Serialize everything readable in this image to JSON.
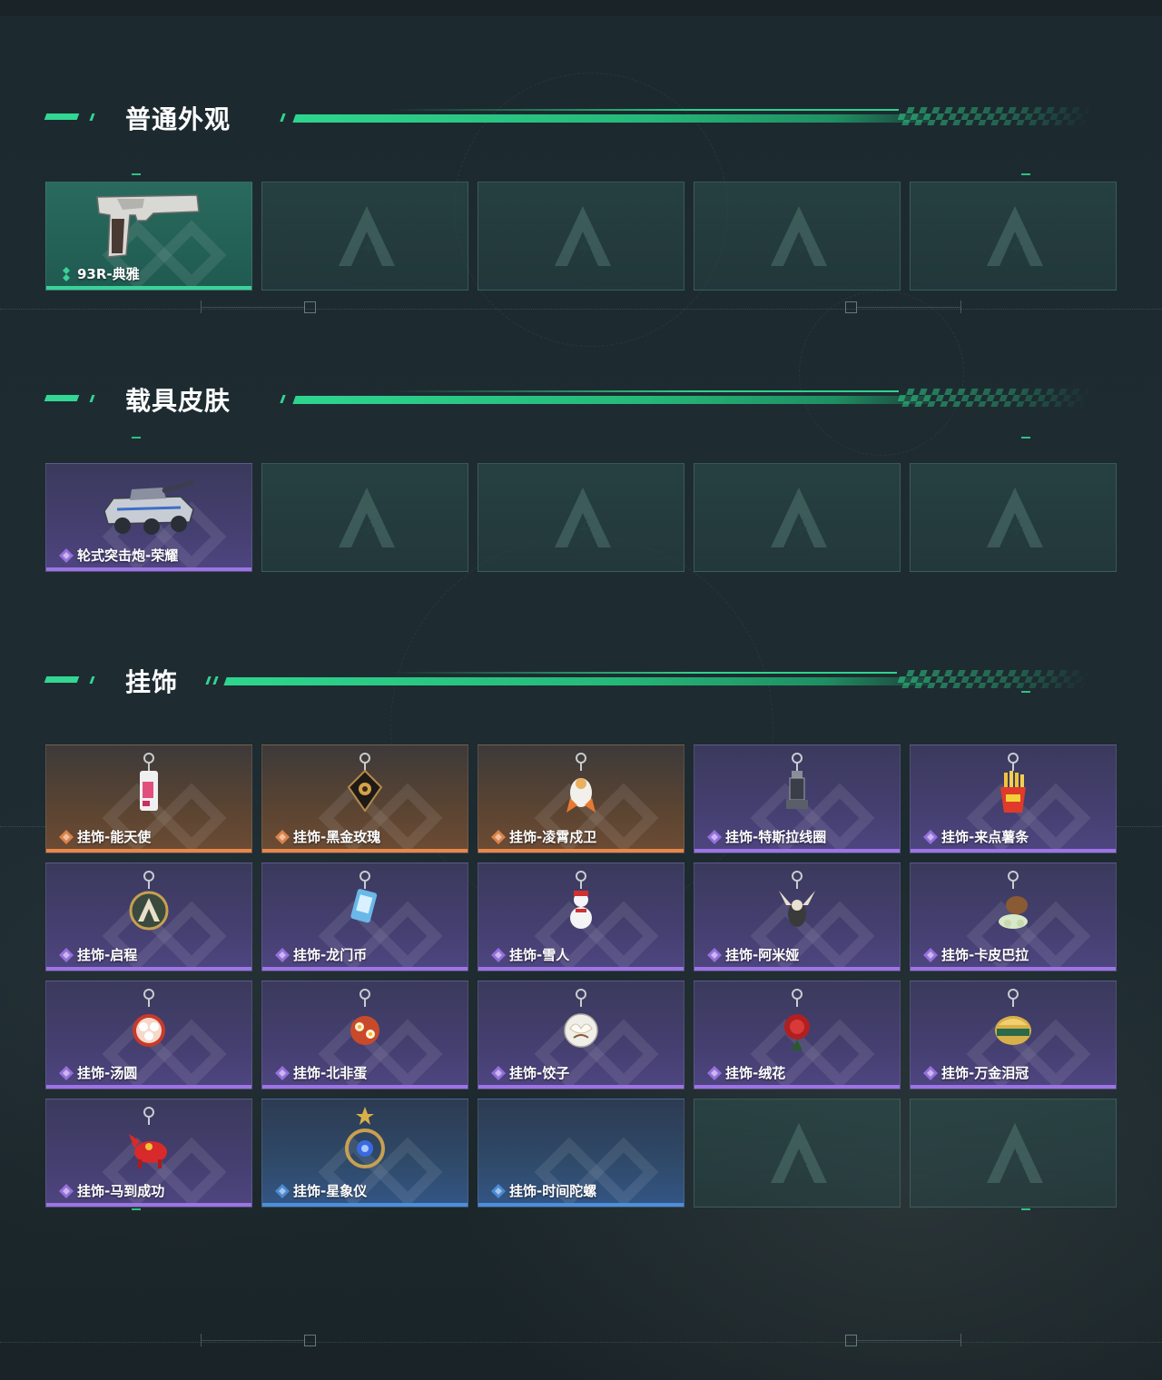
{
  "sections": {
    "normal": {
      "title": "普通外观",
      "items": [
        {
          "name": "93R-典雅",
          "rarity": "green",
          "icon": "pistol-icon"
        },
        {
          "empty": true
        },
        {
          "empty": true
        },
        {
          "empty": true
        },
        {
          "empty": true
        }
      ]
    },
    "vehicle": {
      "title": "载具皮肤",
      "items": [
        {
          "name": "轮式突击炮-荣耀",
          "rarity": "purple",
          "icon": "armored-vehicle-icon"
        },
        {
          "empty": true
        },
        {
          "empty": true
        },
        {
          "empty": true
        },
        {
          "empty": true
        }
      ]
    },
    "charms": {
      "title": "挂饰",
      "items": [
        {
          "name": "挂饰-能天使",
          "rarity": "orange",
          "icon": "angel-charm-icon"
        },
        {
          "name": "挂饰-黑金玫瑰",
          "rarity": "orange",
          "icon": "black-gold-rose-charm-icon"
        },
        {
          "name": "挂饰-凌霄戍卫",
          "rarity": "orange",
          "icon": "guard-charm-icon"
        },
        {
          "name": "挂饰-特斯拉线圈",
          "rarity": "purple",
          "icon": "tesla-coil-charm-icon"
        },
        {
          "name": "挂饰-来点薯条",
          "rarity": "purple",
          "icon": "fries-charm-icon"
        },
        {
          "name": "挂饰-启程",
          "rarity": "purple",
          "icon": "emblem-charm-icon"
        },
        {
          "name": "挂饰-龙门币",
          "rarity": "purple",
          "icon": "coin-card-charm-icon"
        },
        {
          "name": "挂饰-雪人",
          "rarity": "purple",
          "icon": "snowman-charm-icon"
        },
        {
          "name": "挂饰-阿米娅",
          "rarity": "purple",
          "icon": "rabbit-charm-icon"
        },
        {
          "name": "挂饰-卡皮巴拉",
          "rarity": "purple",
          "icon": "capybara-charm-icon"
        },
        {
          "name": "挂饰-汤圆",
          "rarity": "purple",
          "icon": "tangyuan-charm-icon"
        },
        {
          "name": "挂饰-北非蛋",
          "rarity": "purple",
          "icon": "shakshuka-charm-icon"
        },
        {
          "name": "挂饰-饺子",
          "rarity": "purple",
          "icon": "dumpling-charm-icon"
        },
        {
          "name": "挂饰-绒花",
          "rarity": "purple",
          "icon": "velvet-flower-charm-icon"
        },
        {
          "name": "挂饰-万金泪冠",
          "rarity": "purple",
          "icon": "crown-charm-icon"
        },
        {
          "name": "挂饰-马到成功",
          "rarity": "purple",
          "icon": "horse-charm-icon"
        },
        {
          "name": "挂饰-星象仪",
          "rarity": "blue",
          "icon": "astrolabe-charm-icon"
        },
        {
          "name": "挂饰-时间陀螺",
          "rarity": "blue",
          "icon": "spinning-top-charm-icon"
        },
        {
          "empty": true
        },
        {
          "empty": true
        }
      ]
    }
  },
  "colors": {
    "accent": "#33d692",
    "green": "#3ad19a",
    "purple": "#9d74e6",
    "orange": "#e8874a",
    "blue": "#4c8fdb"
  }
}
